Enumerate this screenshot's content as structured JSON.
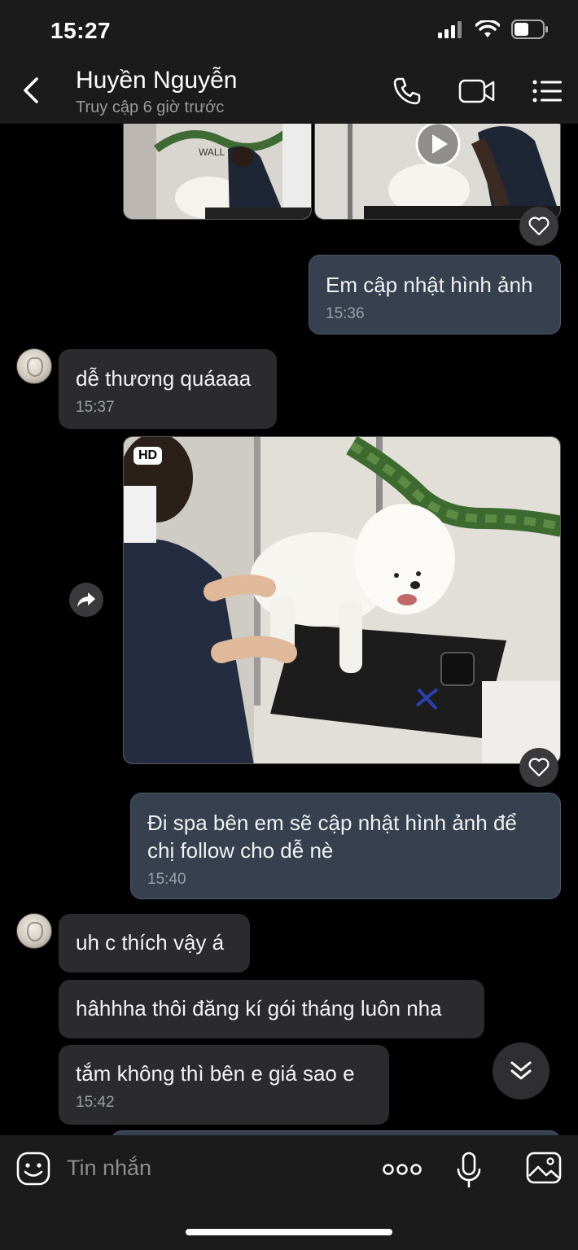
{
  "status_bar": {
    "time": "15:27"
  },
  "header": {
    "contact_name": "Huyền Nguyễn",
    "contact_status": "Truy cập 6 giờ trước"
  },
  "messages": [
    {
      "direction": "out",
      "type": "image-pair"
    },
    {
      "direction": "out",
      "type": "text",
      "text": "Em cập nhật hình ảnh",
      "time": "15:36"
    },
    {
      "direction": "in",
      "type": "text",
      "text": "dễ thương quáaaa",
      "time": "15:37"
    },
    {
      "direction": "out",
      "type": "video",
      "badge": "HD"
    },
    {
      "direction": "out",
      "type": "text",
      "text_line1": "Đi spa bên em sẽ cập nhật hình ảnh để",
      "text_line2": "chị follow cho dễ nè",
      "time": "15:40"
    },
    {
      "direction": "in",
      "type": "text",
      "text": "uh c thích vậy á"
    },
    {
      "direction": "in",
      "type": "text",
      "text": "hâhhha thôi đăng kí gói tháng luôn nha"
    },
    {
      "direction": "in",
      "type": "text",
      "text": "tắm không thì bên e giá sao e",
      "time": "15:42"
    }
  ],
  "input": {
    "placeholder": "Tin nhắn"
  },
  "icons": {
    "back": "chevron-left-icon",
    "call": "phone-icon",
    "video_call": "video-camera-icon",
    "menu": "list-menu-icon",
    "heart": "heart-icon",
    "share": "share-arrow-icon",
    "play": "play-icon",
    "scroll_down": "double-chevron-down-icon",
    "sticker": "sticker-face-icon",
    "more": "more-dots-icon",
    "mic": "microphone-icon",
    "image": "image-icon"
  },
  "colors": {
    "background": "#000000",
    "bar": "#1b1b1b",
    "incoming_bubble": "#2b2b2d",
    "outgoing_bubble": "#36404f"
  }
}
